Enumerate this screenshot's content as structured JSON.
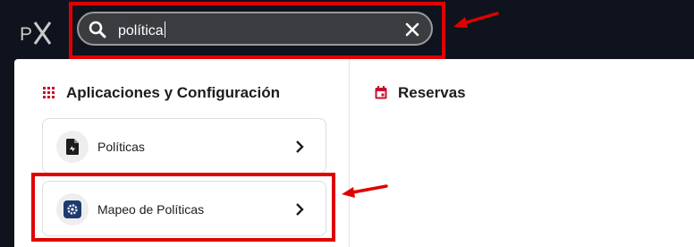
{
  "search": {
    "query": "política"
  },
  "sections": {
    "apps": {
      "title": "Aplicaciones y Configuración"
    },
    "reservas": {
      "title": "Reservas"
    }
  },
  "results": [
    {
      "label": "Políticas",
      "icon": "document-icon"
    },
    {
      "label": "Mapeo de Políticas",
      "icon": "gear-icon"
    }
  ],
  "colors": {
    "annotation": "#e00000",
    "brand_red": "#c8102e",
    "icon_navy": "#1e3a6e"
  }
}
